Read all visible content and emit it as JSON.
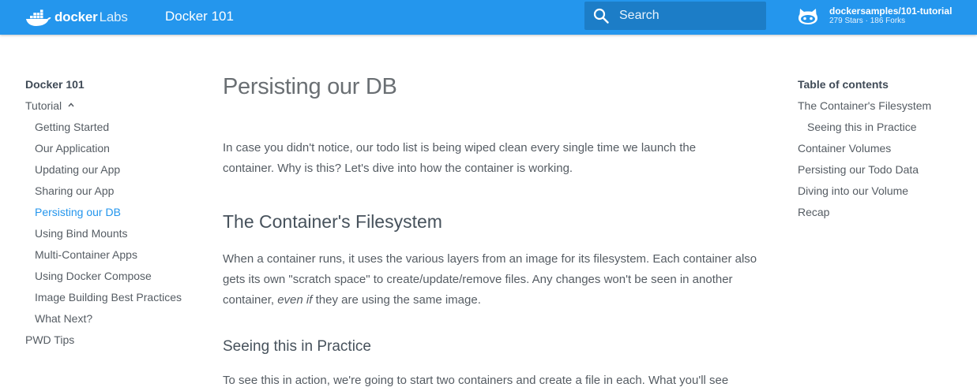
{
  "header": {
    "logo_docker": "docker",
    "logo_labs": "Labs",
    "site_title": "Docker 101",
    "search_placeholder": "Search",
    "repo_name": "dockersamples/101-tutorial",
    "repo_stats": "279 Stars · 186 Forks",
    "brand_color": "#2496ed"
  },
  "nav": {
    "title": "Docker 101",
    "section": "Tutorial",
    "items": [
      {
        "label": "Getting Started"
      },
      {
        "label": "Our Application"
      },
      {
        "label": "Updating our App"
      },
      {
        "label": "Sharing our App"
      },
      {
        "label": "Persisting our DB",
        "active": true
      },
      {
        "label": "Using Bind Mounts"
      },
      {
        "label": "Multi-Container Apps"
      },
      {
        "label": "Using Docker Compose"
      },
      {
        "label": "Image Building Best Practices"
      },
      {
        "label": "What Next?"
      }
    ],
    "footer_item": "PWD Tips",
    "active_color": "#2496ed"
  },
  "content": {
    "title": "Persisting our DB",
    "p1": "In case you didn't notice, our todo list is being wiped clean every single time we launch the container. Why is this? Let's dive into how the container is working.",
    "h2": "The Container's Filesystem",
    "p2_a": "When a container runs, it uses the various layers from an image for its filesystem. Each container also gets its own \"scratch space\" to create/update/remove files. Any changes won't be seen in another container, ",
    "p2_em": "even if",
    "p2_b": " they are using the same image.",
    "h3": "Seeing this in Practice",
    "p3": "To see this in action, we're going to start two containers and create a file in each. What you'll see"
  },
  "toc": {
    "title": "Table of contents",
    "items": [
      {
        "label": "The Container's Filesystem"
      },
      {
        "label": "Seeing this in Practice",
        "sub": true
      },
      {
        "label": "Container Volumes"
      },
      {
        "label": "Persisting our Todo Data"
      },
      {
        "label": "Diving into our Volume"
      },
      {
        "label": "Recap"
      }
    ]
  }
}
